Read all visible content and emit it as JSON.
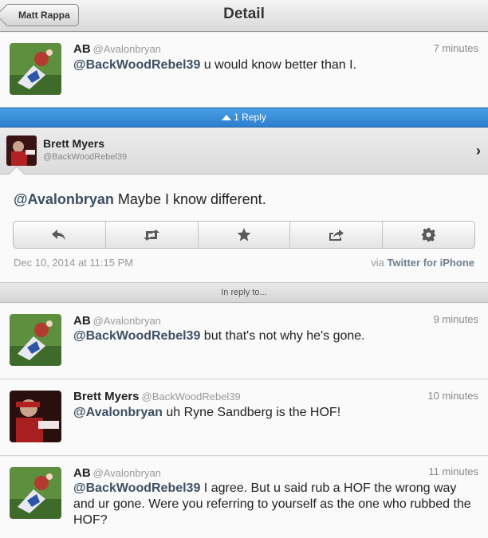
{
  "nav": {
    "back_label": "Matt Rappa",
    "title": "Detail"
  },
  "top_tweet": {
    "name": "AB",
    "handle": "@Avalonbryan",
    "time": "7 minutes",
    "mention": "@BackWoodRebel39",
    "text": " u would know better than I."
  },
  "replies_bar": {
    "label": "1 Reply"
  },
  "detail": {
    "name": "Brett Myers",
    "handle": "@BackWoodRebel39",
    "mention": "@Avalonbryan",
    "text": " Maybe I know different.",
    "actions": [
      "reply-icon",
      "retweet-icon",
      "favorite-icon",
      "share-icon",
      "settings-icon"
    ],
    "date": "Dec 10, 2014 at 11:15 PM",
    "via_prefix": "via ",
    "via_app": "Twitter for iPhone"
  },
  "in_reply_label": "In reply to...",
  "thread": [
    {
      "name": "AB",
      "handle": "@Avalonbryan",
      "time": "9 minutes",
      "mention": "@BackWoodRebel39",
      "text": " but that's not why he's gone."
    },
    {
      "name": "Brett Myers",
      "handle": "@BackWoodRebel39",
      "time": "10 minutes",
      "mention": "@Avalonbryan",
      "text": " uh Ryne Sandberg is the HOF!"
    },
    {
      "name": "AB",
      "handle": "@Avalonbryan",
      "time": "11 minutes",
      "mention": "@BackWoodRebel39",
      "text": " I agree.  But u said rub a HOF the wrong way and ur gone.  Were you referring to yourself as the one who rubbed the HOF?"
    }
  ],
  "colors": {
    "accent_blue": "#2c7fcc",
    "mention": "#3d4f63"
  }
}
